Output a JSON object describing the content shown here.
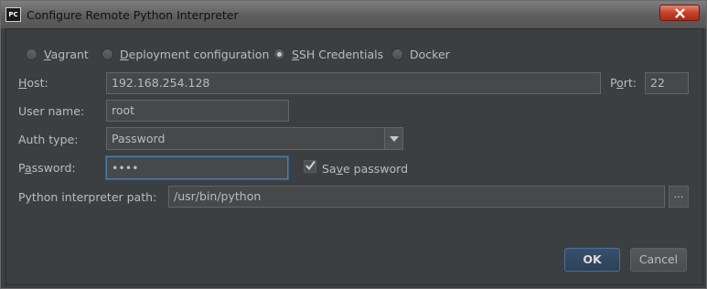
{
  "window": {
    "title": "Configure Remote Python Interpreter",
    "app_icon_text": "PC"
  },
  "radio_options": [
    {
      "label": "Vagrant",
      "mnemonic": "V",
      "rest": "agrant",
      "checked": false
    },
    {
      "label": "Deployment configuration",
      "mnemonic": "D",
      "rest": "eployment configuration",
      "checked": false
    },
    {
      "label": "SSH Credentials",
      "mnemonic": "S",
      "rest": "SH Credentials",
      "checked": true
    },
    {
      "label": "Docker",
      "mnemonic": "",
      "rest": "Docker",
      "checked": false
    }
  ],
  "host": {
    "label_mnemonic": "H",
    "label_rest": "ost:",
    "value": "192.168.254.128"
  },
  "port": {
    "label_pre": "P",
    "label_mnemonic": "o",
    "label_rest": "rt:",
    "value": "22"
  },
  "username": {
    "label": "User name:",
    "value": "root"
  },
  "auth_type": {
    "label": "Auth type:",
    "value": "Password"
  },
  "password": {
    "label_pre": "P",
    "label_mnemonic": "a",
    "label_rest": "ssword:",
    "value": "••••"
  },
  "save_password": {
    "label_pre": "Sa",
    "label_mnemonic": "v",
    "label_rest": "e password",
    "checked": true
  },
  "interpreter_path": {
    "label": "Python interpreter path:",
    "value": "/usr/bin/python",
    "browse_label": "..."
  },
  "buttons": {
    "ok": "OK",
    "cancel": "Cancel"
  }
}
